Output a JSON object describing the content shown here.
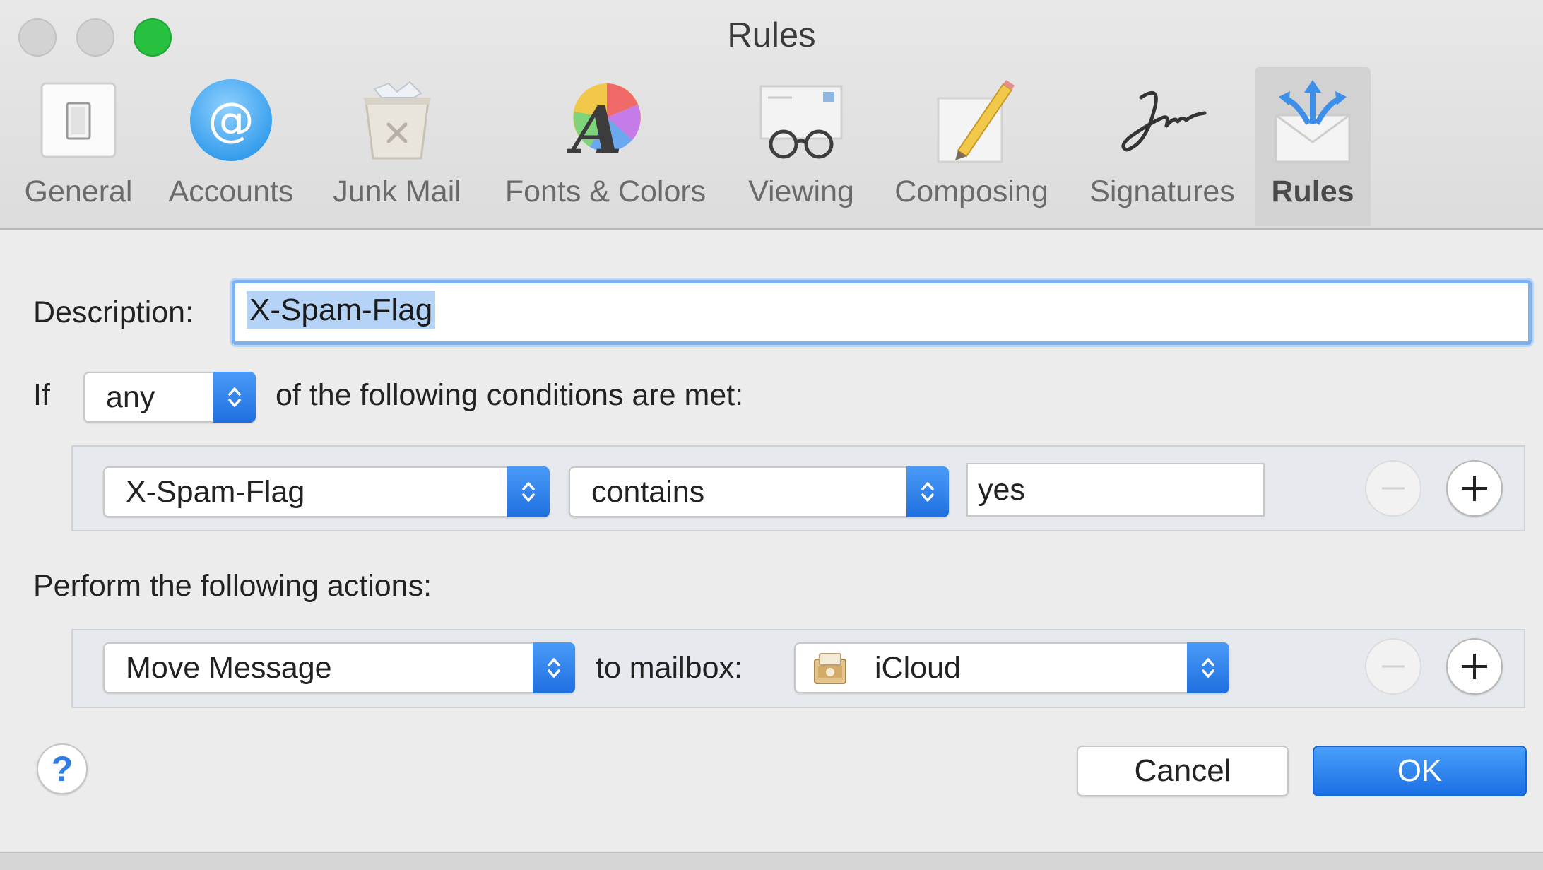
{
  "window": {
    "title": "Rules"
  },
  "toolbar": {
    "items": [
      {
        "label": "General",
        "icon": "general-switch-icon"
      },
      {
        "label": "Accounts",
        "icon": "at-sign-icon"
      },
      {
        "label": "Junk Mail",
        "icon": "trash-bin-icon"
      },
      {
        "label": "Fonts & Colors",
        "icon": "font-color-wheel-icon"
      },
      {
        "label": "Viewing",
        "icon": "glasses-icon"
      },
      {
        "label": "Composing",
        "icon": "pencil-paper-icon"
      },
      {
        "label": "Signatures",
        "icon": "signature-icon"
      },
      {
        "label": "Rules",
        "icon": "envelope-arrows-icon"
      }
    ],
    "selected": "Rules"
  },
  "form": {
    "description_label": "Description:",
    "description_value": "X-Spam-Flag",
    "if_label": "If",
    "match_mode": "any",
    "conditions_suffix": "of the following conditions are met:",
    "condition": {
      "field": "X-Spam-Flag",
      "operator": "contains",
      "value": "yes"
    },
    "actions_label": "Perform the following actions:",
    "action": {
      "type": "Move Message",
      "connector": "to mailbox:",
      "mailbox": "iCloud"
    }
  },
  "buttons": {
    "help": "?",
    "cancel": "Cancel",
    "ok": "OK"
  },
  "colors": {
    "accent": "#2a7ff0",
    "traffic_zoom": "#27c13f"
  }
}
